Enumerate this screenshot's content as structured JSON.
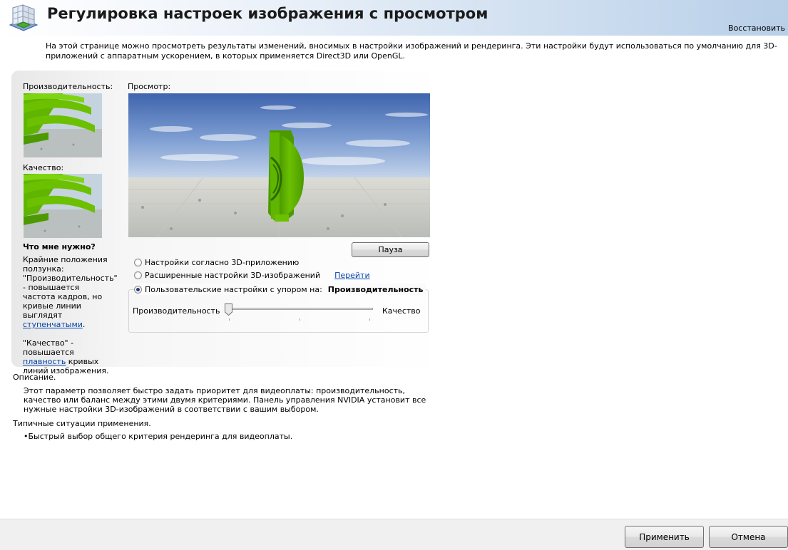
{
  "header": {
    "title": "Регулировка настроек изображения с просмотром",
    "restore_label": "Восстановить"
  },
  "intro_text": "На этой странице можно просмотреть результаты изменений, вносимых в настройки изображений и рендеринга. Эти настройки будут использоваться по умолчанию для 3D-приложений с аппаратным ускорением, в которых применяется Direct3D или OpenGL.",
  "left": {
    "performance_label": "Производительность:",
    "quality_label": "Качество:",
    "help_title": "Что мне нужно?",
    "help_p1_before": "Крайние положения ползунка: \"Производительность\" - повышается частота кадров, но кривые линии выглядят ",
    "help_p1_link": "ступенчатыми",
    "help_p1_after": ".",
    "help_p2_before": "\"Качество\" - повышается ",
    "help_p2_link": "плавность",
    "help_p2_after": " кривых линий изображения."
  },
  "preview": {
    "label": "Просмотр:",
    "pause_label": "Пауза"
  },
  "options": {
    "radio1": "Настройки согласно 3D-приложению",
    "radio2": "Расширенные настройки 3D-изображений",
    "go_link": "Перейти",
    "radio3": "Пользовательские настройки с упором на:",
    "emphasis_value": "Производительность",
    "selected_index": 2
  },
  "slider": {
    "left_label": "Производительность",
    "right_label": "Качество",
    "value_percent": 0
  },
  "description": {
    "title": "Описание.",
    "text": "Этот параметр позволяет быстро задать приоритет для видеоплаты: производительность, качество или баланс между этими двумя критериями. Панель управления NVIDIA установит все нужные настройки 3D-изображений в соответствии с вашим выбором."
  },
  "usage": {
    "title": "Типичные ситуации применения.",
    "items": [
      "Быстрый выбор общего критерия рендеринга для видеоплаты."
    ]
  },
  "footer": {
    "apply_label": "Применить",
    "cancel_label": "Отмена"
  },
  "colors": {
    "accent_green": "#6cc000",
    "link_blue": "#0645ad",
    "sky_blue": "#4a72b8"
  },
  "icons": {
    "header": "display-settings-icon",
    "pause": "none"
  }
}
